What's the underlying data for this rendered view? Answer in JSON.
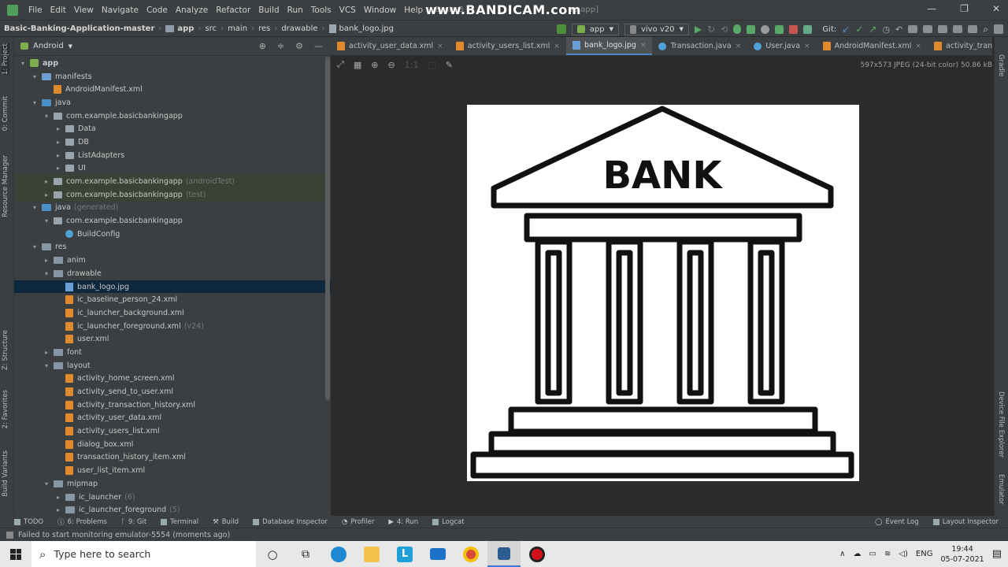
{
  "menu": {
    "items": [
      "File",
      "Edit",
      "View",
      "Navigate",
      "Code",
      "Analyze",
      "Refactor",
      "Build",
      "Run",
      "Tools",
      "VCS",
      "Window",
      "Help"
    ],
    "title_left": "Basic B",
    "title_right": "pp.app]",
    "watermark": "www.BANDICAM.com"
  },
  "nav": {
    "crumbs": [
      "Basic-Banking-Application-master",
      "app",
      "src",
      "main",
      "res",
      "drawable",
      "bank_logo.jpg"
    ],
    "run_config": "app",
    "device": "vivo v20",
    "git_label": "Git:"
  },
  "left_stripe": {
    "project": "1: Project",
    "commit": "0: Commit",
    "resource_manager": "Resource Manager",
    "structure": "Z: Structure",
    "favorites": "2: Favorites",
    "build_variants": "Build Variants"
  },
  "right_stripe": {
    "gradle": "Gradle",
    "device_explorer": "Device File Explorer",
    "emulator": "Emulator"
  },
  "project": {
    "view_mode": "Android",
    "tree": [
      {
        "label": "app",
        "depth": 0,
        "arrow": "▾",
        "icon": "app",
        "bold": true
      },
      {
        "label": "manifests",
        "depth": 1,
        "arrow": "▾",
        "icon": "fold blue"
      },
      {
        "label": "AndroidManifest.xml",
        "depth": 2,
        "arrow": "",
        "icon": "xml"
      },
      {
        "label": "java",
        "depth": 1,
        "arrow": "▾",
        "icon": "fold java"
      },
      {
        "label": "com.example.basicbankingapp",
        "depth": 2,
        "arrow": "▾",
        "icon": "pkg"
      },
      {
        "label": "Data",
        "depth": 3,
        "arrow": "▸",
        "icon": "pkg"
      },
      {
        "label": "DB",
        "depth": 3,
        "arrow": "▸",
        "icon": "pkg"
      },
      {
        "label": "ListAdapters",
        "depth": 3,
        "arrow": "▸",
        "icon": "pkg"
      },
      {
        "label": "UI",
        "depth": 3,
        "arrow": "▸",
        "icon": "pkg"
      },
      {
        "label": "com.example.basicbankingapp",
        "depth": 2,
        "arrow": "▸",
        "icon": "pkg",
        "note": "(androidTest)",
        "hl": true
      },
      {
        "label": "com.example.basicbankingapp",
        "depth": 2,
        "arrow": "▸",
        "icon": "pkg",
        "note": "(test)",
        "hl": true
      },
      {
        "label": "java",
        "depth": 1,
        "arrow": "▾",
        "icon": "fold java",
        "note": "(generated)"
      },
      {
        "label": "com.example.basicbankingapp",
        "depth": 2,
        "arrow": "▾",
        "icon": "pkg"
      },
      {
        "label": "BuildConfig",
        "depth": 3,
        "arrow": "",
        "icon": "cls"
      },
      {
        "label": "res",
        "depth": 1,
        "arrow": "▾",
        "icon": "fold"
      },
      {
        "label": "anim",
        "depth": 2,
        "arrow": "▸",
        "icon": "fold"
      },
      {
        "label": "drawable",
        "depth": 2,
        "arrow": "▾",
        "icon": "fold"
      },
      {
        "label": "bank_logo.jpg",
        "depth": 3,
        "arrow": "",
        "icon": "img",
        "sel": true
      },
      {
        "label": "ic_baseline_person_24.xml",
        "depth": 3,
        "arrow": "",
        "icon": "xml"
      },
      {
        "label": "ic_launcher_background.xml",
        "depth": 3,
        "arrow": "",
        "icon": "xml"
      },
      {
        "label": "ic_launcher_foreground.xml",
        "depth": 3,
        "arrow": "",
        "icon": "xml",
        "note": "(v24)"
      },
      {
        "label": "user.xml",
        "depth": 3,
        "arrow": "",
        "icon": "xml"
      },
      {
        "label": "font",
        "depth": 2,
        "arrow": "▸",
        "icon": "fold"
      },
      {
        "label": "layout",
        "depth": 2,
        "arrow": "▾",
        "icon": "fold"
      },
      {
        "label": "activity_home_screen.xml",
        "depth": 3,
        "arrow": "",
        "icon": "xml"
      },
      {
        "label": "activity_send_to_user.xml",
        "depth": 3,
        "arrow": "",
        "icon": "xml"
      },
      {
        "label": "activity_transaction_history.xml",
        "depth": 3,
        "arrow": "",
        "icon": "xml"
      },
      {
        "label": "activity_user_data.xml",
        "depth": 3,
        "arrow": "",
        "icon": "xml"
      },
      {
        "label": "activity_users_list.xml",
        "depth": 3,
        "arrow": "",
        "icon": "xml"
      },
      {
        "label": "dialog_box.xml",
        "depth": 3,
        "arrow": "",
        "icon": "xml"
      },
      {
        "label": "transaction_history_item.xml",
        "depth": 3,
        "arrow": "",
        "icon": "xml"
      },
      {
        "label": "user_list_item.xml",
        "depth": 3,
        "arrow": "",
        "icon": "xml"
      },
      {
        "label": "mipmap",
        "depth": 2,
        "arrow": "▾",
        "icon": "fold"
      },
      {
        "label": "ic_launcher",
        "depth": 3,
        "arrow": "▸",
        "icon": "fold",
        "note": "(6)"
      },
      {
        "label": "ic_launcher_foreground",
        "depth": 3,
        "arrow": "▸",
        "icon": "fold",
        "note": "(5)"
      }
    ]
  },
  "editor": {
    "tabs": [
      {
        "label": "activity_user_data.xml",
        "icon": "xml"
      },
      {
        "label": "activity_users_list.xml",
        "icon": "xml"
      },
      {
        "label": "bank_logo.jpg",
        "icon": "img",
        "active": true
      },
      {
        "label": "Transaction.java",
        "icon": "cls"
      },
      {
        "label": "User.java",
        "icon": "cls"
      },
      {
        "label": "AndroidManifest.xml",
        "icon": "xml"
      },
      {
        "label": "activity_transaction_l",
        "icon": "xml"
      }
    ],
    "image_info": "597x573 JPEG (24-bit color) 50.86 kB",
    "image_text": "BANK"
  },
  "bottom_tools": [
    "TODO",
    "6: Problems",
    "9: Git",
    "Terminal",
    "Build",
    "Database Inspector",
    "Profiler",
    "4: Run",
    "Logcat"
  ],
  "bottom_right": [
    "Event Log",
    "Layout Inspector"
  ],
  "status": "Failed to start monitoring emulator-5554 (moments ago)",
  "taskbar": {
    "search_placeholder": "Type here to search",
    "language": "ENG",
    "time": "19:44",
    "date": "05-07-2021"
  }
}
